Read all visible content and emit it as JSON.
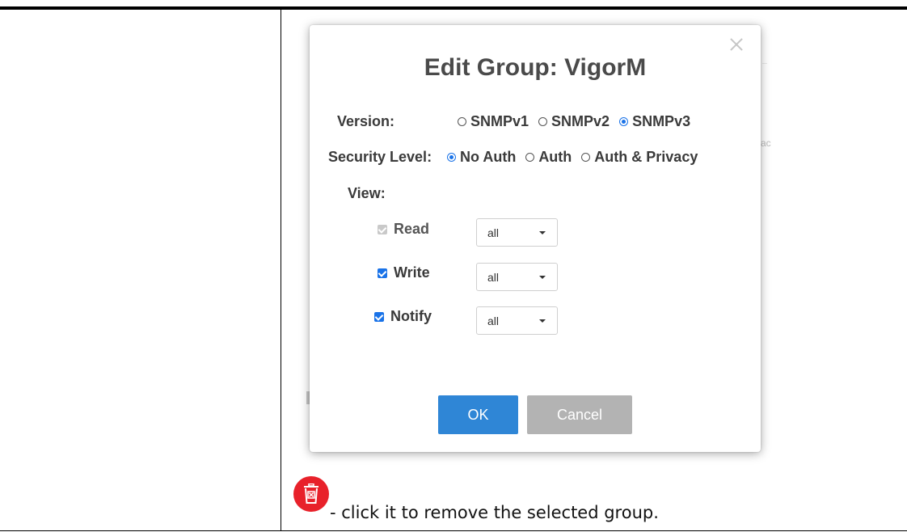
{
  "dialog": {
    "title": "Edit Group: VigorM",
    "version_label": "Version:",
    "version_options": [
      "SNMPv1",
      "SNMPv2",
      "SNMPv3"
    ],
    "version_selected": "SNMPv3",
    "security_label": "Security Level:",
    "security_options": [
      "No Auth",
      "Auth",
      "Auth & Privacy"
    ],
    "security_selected": "No Auth",
    "view_label": "View:",
    "views": [
      {
        "label": "Read",
        "checked": true,
        "disabled": true,
        "value": "all"
      },
      {
        "label": "Write",
        "checked": true,
        "disabled": false,
        "value": "all"
      },
      {
        "label": "Notify",
        "checked": true,
        "disabled": false,
        "value": "all"
      }
    ],
    "ok_label": "OK",
    "cancel_label": "Cancel"
  },
  "note": {
    "icon": "trash-icon",
    "text": "- click it to remove the selected group."
  },
  "colors": {
    "accent": "#1a73e8",
    "ok_button": "#2f86d6",
    "cancel_button": "#b3b3b3",
    "delete_icon": "#e8212a"
  }
}
